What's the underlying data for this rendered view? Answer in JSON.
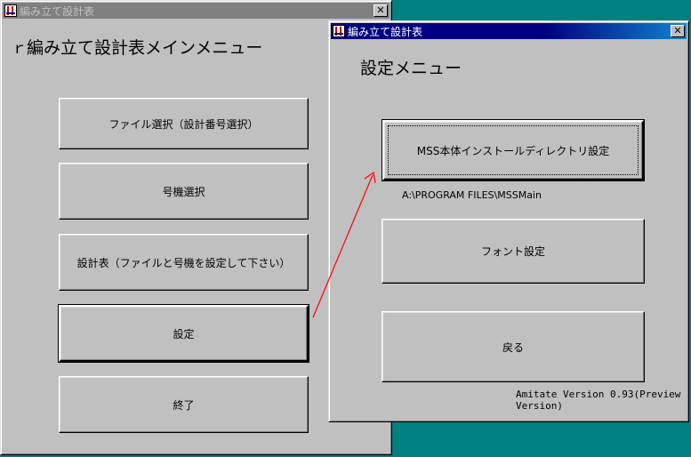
{
  "main_window": {
    "title": "編み立て設計表",
    "heading": "編み立て設計表メインメニュー",
    "buttons": {
      "file_select": "ファイル選択（設計番号選択）",
      "machine_select": "号機選択",
      "design_table": "設計表（ファイルと号機を設定して下さい）",
      "settings": "設定",
      "exit": "終了"
    }
  },
  "settings_window": {
    "title": "編み立て設計表",
    "heading": "設定メニュー",
    "buttons": {
      "install_dir": "MSS本体インストールディレクトリ設定",
      "font": "フォント設定",
      "back": "戻る"
    },
    "install_path": "A:\\PROGRAM FILES\\MSSMain",
    "version": "Amitate Version 0.93(Preview Version)"
  },
  "colors": {
    "desktop": "#008080",
    "window": "#c0c0c0",
    "active_title": "#000080",
    "inactive_title": "#808080",
    "arrow": "#ff0000"
  }
}
